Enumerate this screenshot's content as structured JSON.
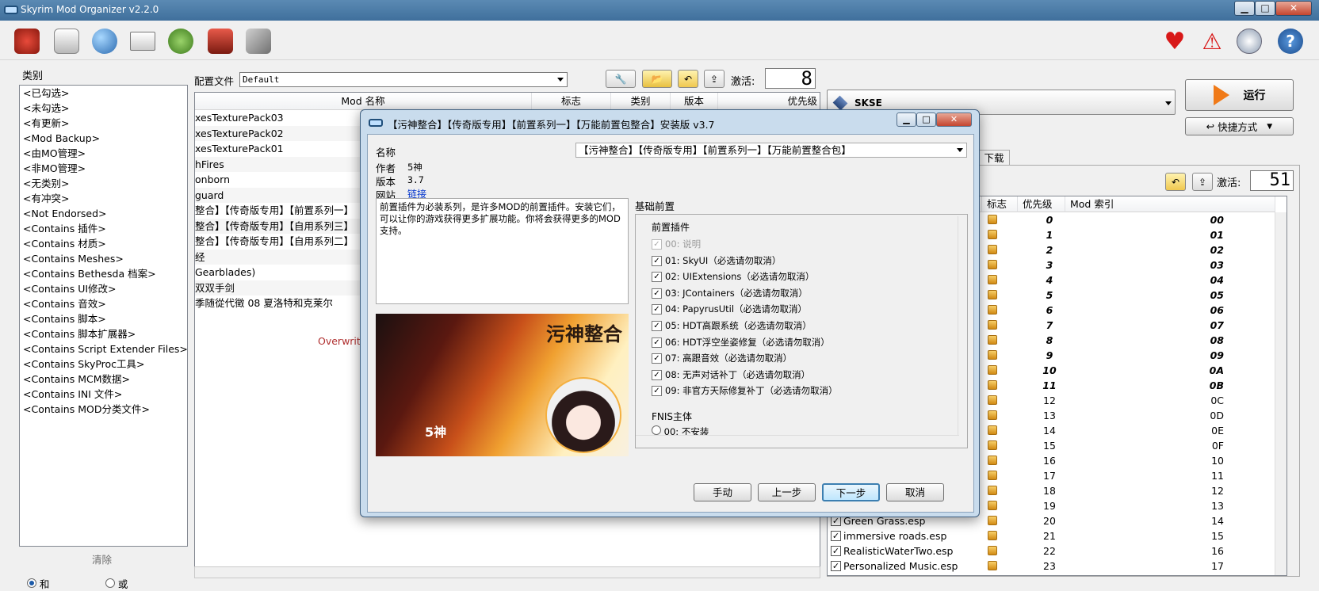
{
  "window": {
    "title": "Skyrim Mod Organizer v2.2.0",
    "min": "▁",
    "max": "□",
    "close": "✕"
  },
  "toolbar": {
    "icons": [
      "install-mod-icon",
      "nexus-icon",
      "globe-icon",
      "profiles-icon",
      "tools-icon",
      "executables-icon",
      "settings-icon"
    ],
    "right_icons": [
      "endorse-heart-icon",
      "problems-warning-icon",
      "update-icon",
      "help-icon"
    ]
  },
  "categories": {
    "title": "类别",
    "items": [
      "<已勾选>",
      "<未勾选>",
      "<有更新>",
      "<Mod Backup>",
      "<由MO管理>",
      "<非MO管理>",
      "<无类别>",
      "<有冲突>",
      "<Not Endorsed>",
      "<Contains 插件>",
      "<Contains 材质>",
      "<Contains Meshes>",
      "<Contains Bethesda 档案>",
      "<Contains UI修改>",
      "<Contains 音效>",
      "<Contains 脚本>",
      "<Contains 脚本扩展器>",
      "<Contains Script Extender Files>",
      "<Contains SkyProc工具>",
      "<Contains MCM数据>",
      "<Contains INI 文件>",
      "<Contains MOD分类文件>"
    ],
    "clear": "清除",
    "and": "和",
    "or": "或"
  },
  "profile": {
    "label": "配置文件",
    "value": "Default",
    "active_label": "激活:",
    "active_count": "8"
  },
  "modlist": {
    "headers": {
      "name": "Mod 名称",
      "flags": "标志",
      "category": "类别",
      "version": "版本",
      "priority": "优先级"
    },
    "rows": [
      "xesTexturePack03",
      "xesTexturePack02",
      "xesTexturePack01",
      "hFires",
      "onborn",
      "guard",
      "整合】【传奇版专用】【前置系列一】",
      "整合】【传奇版专用】【自用系列三】",
      "整合】【传奇版专用】【自用系列二】",
      "经",
      "Gearblades)",
      "双双手剑",
      "季随從代徵 08 夏洛特和克莱尔"
    ],
    "overwrite": "Overwrite"
  },
  "right": {
    "executable": "SKSE",
    "run": "运行",
    "shortcut": "快捷方式",
    "downloads_tab": "下载",
    "active_label": "激活:",
    "active_count": "51",
    "headers": {
      "flags": "标志",
      "priority": "优先级",
      "index": "Mod 索引"
    },
    "plugins": [
      {
        "name": "",
        "priority": "0",
        "index": "00",
        "bold": true
      },
      {
        "name": "",
        "priority": "1",
        "index": "01",
        "bold": true
      },
      {
        "name": "",
        "priority": "2",
        "index": "02",
        "bold": true
      },
      {
        "name": "",
        "priority": "3",
        "index": "03",
        "bold": true
      },
      {
        "name": "",
        "priority": "4",
        "index": "04",
        "bold": true
      },
      {
        "name": "",
        "priority": "5",
        "index": "05",
        "bold": true
      },
      {
        "name": "",
        "priority": "6",
        "index": "06",
        "bold": true
      },
      {
        "name": "",
        "priority": "7",
        "index": "07",
        "bold": true
      },
      {
        "name": "",
        "priority": "8",
        "index": "08",
        "bold": true
      },
      {
        "name": "",
        "priority": "9",
        "index": "09",
        "bold": true
      },
      {
        "name": "",
        "priority": "10",
        "index": "0A",
        "bold": true
      },
      {
        "name": "",
        "priority": "11",
        "index": "0B",
        "bold": true
      },
      {
        "name": "",
        "priority": "12",
        "index": "0C",
        "bold": false
      },
      {
        "name": "",
        "priority": "13",
        "index": "0D",
        "bold": false
      },
      {
        "name": "",
        "priority": "14",
        "index": "0E",
        "bold": false
      },
      {
        "name": "",
        "priority": "15",
        "index": "0F",
        "bold": false
      },
      {
        "name": "",
        "priority": "16",
        "index": "10",
        "bold": false
      },
      {
        "name": "",
        "priority": "17",
        "index": "11",
        "bold": false
      },
      {
        "name": "",
        "priority": "18",
        "index": "12",
        "bold": false
      },
      {
        "name": "",
        "priority": "19",
        "index": "13",
        "bold": false
      },
      {
        "name": "Green Grass.esp",
        "priority": "20",
        "index": "14",
        "bold": false
      },
      {
        "name": "immersive roads.esp",
        "priority": "21",
        "index": "15",
        "bold": false
      },
      {
        "name": "RealisticWaterTwo.esp",
        "priority": "22",
        "index": "16",
        "bold": false
      },
      {
        "name": "Personalized Music.esp",
        "priority": "23",
        "index": "17",
        "bold": false
      }
    ]
  },
  "dialog": {
    "title": "【污神整合】【传奇版专用】【前置系列一】【万能前置包整合】安装版 v3.7",
    "name_label": "名称",
    "name_value": "【污神整合】【传奇版专用】【前置系列一】【万能前置整合包】",
    "author_label": "作者",
    "author_value": "5神",
    "version_label": "版本",
    "version_value": "3.7",
    "site_label": "网站",
    "site_value": "链接",
    "description": "前置插件为必装系列，是许多MOD的前置插件。安装它们，可以让你的游戏获得更多扩展功能。你将会获得更多的MOD支持。",
    "banner_text": "污神整合",
    "banner_sub": "5神",
    "group_title": "基础前置",
    "sub_group1": "前置插件",
    "options": [
      {
        "label": "00: 说明",
        "checked": true,
        "disabled": true
      },
      {
        "label": "01: SkyUI（必选请勿取消）",
        "checked": true,
        "disabled": false
      },
      {
        "label": "02: UIExtensions（必选请勿取消）",
        "checked": true,
        "disabled": false
      },
      {
        "label": "03: JContainers（必选请勿取消）",
        "checked": true,
        "disabled": false
      },
      {
        "label": "04: PapyrusUtil（必选请勿取消）",
        "checked": true,
        "disabled": false
      },
      {
        "label": "05: HDT高跟系统（必选请勿取消）",
        "checked": true,
        "disabled": false
      },
      {
        "label": "06: HDT浮空坐姿修复（必选请勿取消）",
        "checked": true,
        "disabled": false
      },
      {
        "label": "07: 高跟音效（必选请勿取消）",
        "checked": true,
        "disabled": false
      },
      {
        "label": "08: 无声对话补丁（必选请勿取消）",
        "checked": true,
        "disabled": false
      },
      {
        "label": "09: 非官方天际修复补丁（必选请勿取消）",
        "checked": true,
        "disabled": false
      }
    ],
    "sub_group2": "FNIS主体",
    "option_fnis": "00: 不安装",
    "buttons": {
      "manual": "手动",
      "prev": "上一步",
      "next": "下一步",
      "cancel": "取消"
    }
  }
}
